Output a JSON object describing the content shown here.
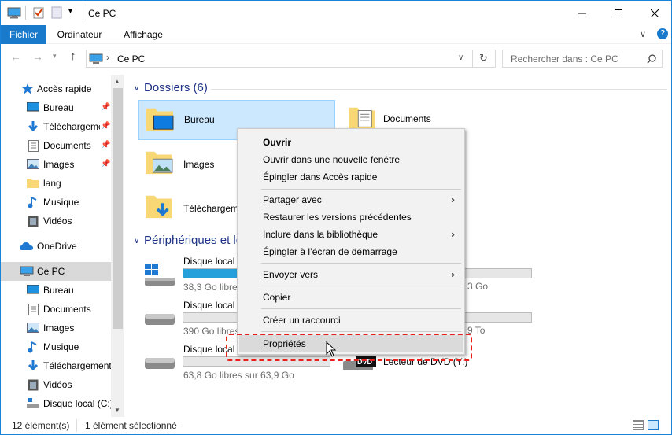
{
  "window": {
    "title": "Ce PC"
  },
  "ribbon": {
    "tabs": [
      "Fichier",
      "Ordinateur",
      "Affichage"
    ]
  },
  "address": {
    "path": "Ce PC",
    "search_placeholder": "Rechercher dans : Ce PC"
  },
  "sidebar": {
    "quick_access": "Accès rapide",
    "quick_items": [
      "Bureau",
      "Téléchargements",
      "Documents",
      "Images",
      "lang",
      "Musique",
      "Vidéos"
    ],
    "onedrive": "OneDrive",
    "this_pc": "Ce PC",
    "pc_items": [
      "Bureau",
      "Documents",
      "Images",
      "Musique",
      "Téléchargements",
      "Vidéos",
      "Disque local (C:)"
    ]
  },
  "content": {
    "folders_header": "Dossiers (6)",
    "folders": [
      "Bureau",
      "Documents",
      "Images",
      "Téléchargements"
    ],
    "devices_header": "Périphériques et lecteurs",
    "drives": [
      {
        "label": "Disque local",
        "free": "38,3 Go libres",
        "used_fraction": 0.44
      },
      {
        "label": "Disque local",
        "free": "390 Go libres",
        "used_fraction": 0.0
      },
      {
        "label": "Disque local",
        "free": "63,8 Go libres sur 63,9 Go",
        "used_fraction": 0.0
      }
    ],
    "right_drive_free": [
      "3 Go",
      "9 To"
    ],
    "dvd_label": "Lecteur de DVD (Y:)",
    "dvd_badge": "DVD"
  },
  "context_menu": {
    "open": "Ouvrir",
    "open_new_window": "Ouvrir dans une nouvelle fenêtre",
    "pin_quick": "Épingler dans Accès rapide",
    "share_with": "Partager avec",
    "restore": "Restaurer les versions précédentes",
    "include_library": "Inclure dans la bibliothèque",
    "pin_start": "Épingler à l’écran de démarrage",
    "send_to": "Envoyer vers",
    "copy": "Copier",
    "create_shortcut": "Créer un raccourci",
    "properties": "Propriétés"
  },
  "status": {
    "count": "12 élément(s)",
    "selected": "1 élément sélectionné"
  },
  "colors": {
    "accent": "#1979ca",
    "selection": "#cce8ff",
    "highlight_dash": "#e8201a"
  }
}
